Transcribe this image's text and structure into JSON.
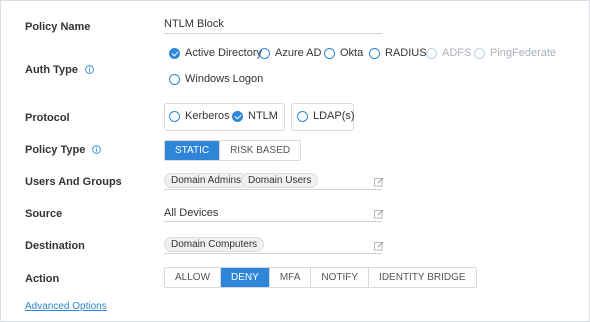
{
  "policy_name": {
    "label": "Policy Name",
    "value": "NTLM Block"
  },
  "auth_type": {
    "label": "Auth Type",
    "info_icon": "info-icon",
    "options": [
      {
        "label": "Active Directory",
        "checked": true,
        "disabled": false
      },
      {
        "label": "Azure AD",
        "checked": false,
        "disabled": false
      },
      {
        "label": "Okta",
        "checked": false,
        "disabled": false
      },
      {
        "label": "RADIUS",
        "checked": false,
        "disabled": false
      },
      {
        "label": "ADFS",
        "checked": false,
        "disabled": true
      },
      {
        "label": "PingFederate",
        "checked": false,
        "disabled": true
      },
      {
        "label": "Windows Logon",
        "checked": false,
        "disabled": false
      }
    ]
  },
  "protocol": {
    "label": "Protocol",
    "options": [
      {
        "label": "Kerberos",
        "checked": false
      },
      {
        "label": "NTLM",
        "checked": true
      },
      {
        "label": "LDAP(s)",
        "checked": false
      }
    ]
  },
  "policy_type": {
    "label": "Policy Type",
    "info_icon": "info-icon",
    "options": [
      "STATIC",
      "RISK BASED"
    ],
    "selected": "STATIC"
  },
  "users_and_groups": {
    "label": "Users And Groups",
    "chips": [
      "Domain Admins",
      "Domain Users"
    ],
    "edit_icon": "edit-icon"
  },
  "source": {
    "label": "Source",
    "value": "All Devices",
    "edit_icon": "edit-icon"
  },
  "destination": {
    "label": "Destination",
    "chips": [
      "Domain Computers"
    ],
    "edit_icon": "edit-icon"
  },
  "action": {
    "label": "Action",
    "options": [
      "ALLOW",
      "DENY",
      "MFA",
      "NOTIFY",
      "IDENTITY BRIDGE"
    ],
    "selected": "DENY"
  },
  "advanced_options": {
    "label": "Advanced Options"
  },
  "colors": {
    "accent": "#2f86d9",
    "border": "#d6dbe0",
    "chip_bg": "#eef0f2",
    "disabled_text": "#aab1b8"
  }
}
